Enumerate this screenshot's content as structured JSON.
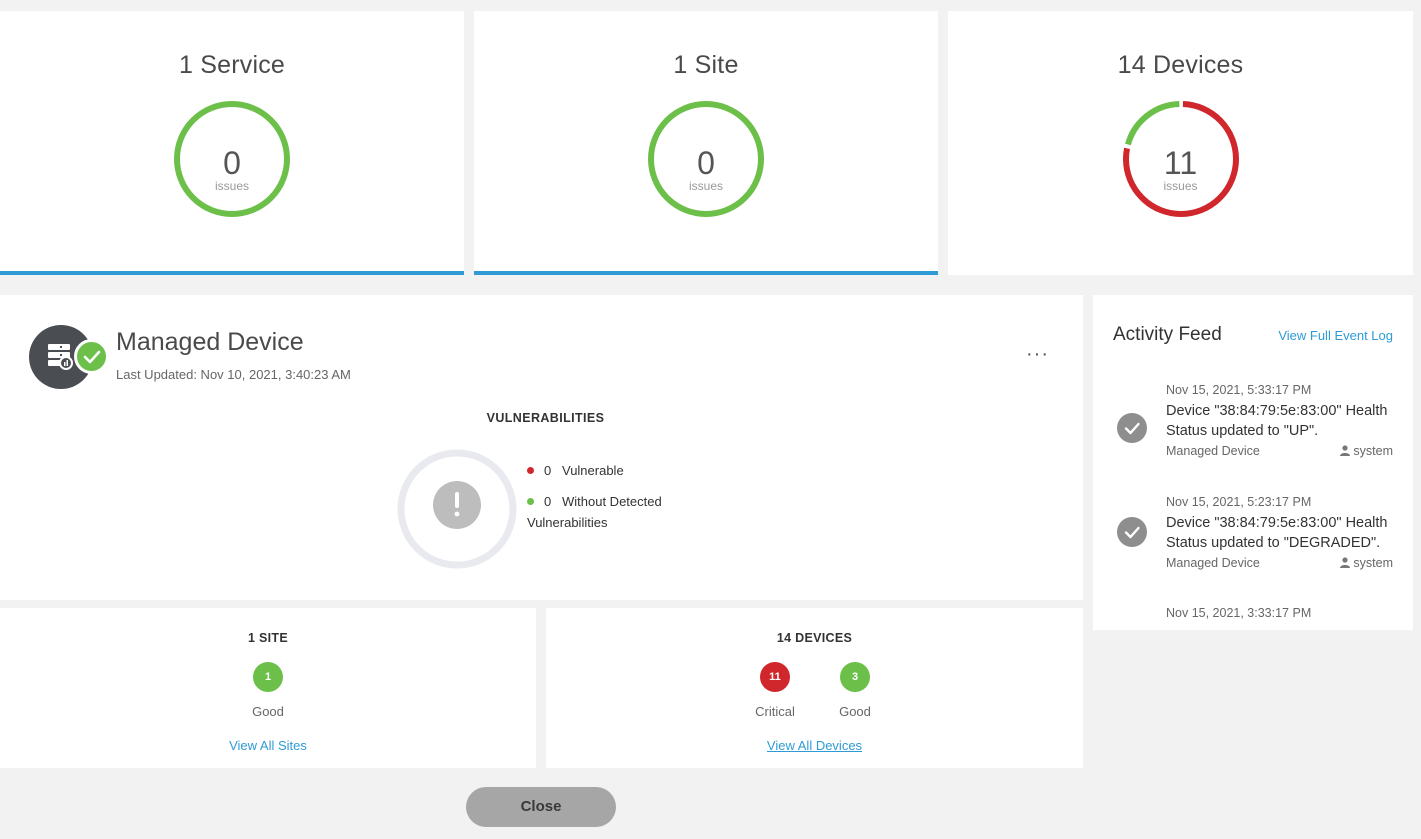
{
  "summary": {
    "service": {
      "title": "1 Service",
      "count": "0",
      "sub": "issues"
    },
    "site": {
      "title": "1 Site",
      "count": "0",
      "sub": "issues"
    },
    "devices": {
      "title": "14 Devices",
      "count": "11",
      "sub": "issues",
      "critical_fraction": 0.786,
      "good_fraction": 0.214
    }
  },
  "colors": {
    "good": "#6cc04a",
    "critical": "#d0272c",
    "accent": "#2e9bd6",
    "link": "#2e9bd6",
    "neutral_ring": "#e9eaef",
    "warn_icon": "#bdbdbd"
  },
  "device": {
    "name": "Managed Device",
    "last_updated": "Last Updated: Nov 10, 2021, 3:40:23 AM",
    "more_label": "···",
    "icon": "server-health-icon",
    "status_icon": "check-circle-icon"
  },
  "vulnerabilities": {
    "title": "VULNERABILITIES",
    "icon": "exclamation-icon",
    "legend": [
      {
        "count": "0",
        "label": "Vulnerable",
        "color": "#d0272c"
      },
      {
        "count": "0",
        "label": "Without Detected",
        "label2": "Vulnerabilities",
        "color": "#6cc04a"
      }
    ]
  },
  "sites_card": {
    "label": "1 SITE",
    "pills": [
      {
        "value": "1",
        "label": "Good",
        "color": "#6cc04a"
      }
    ],
    "link": "View All Sites"
  },
  "devices_card": {
    "label": "14 DEVICES",
    "pills": [
      {
        "value": "11",
        "label": "Critical",
        "color": "#d0272c"
      },
      {
        "value": "3",
        "label": "Good",
        "color": "#6cc04a"
      }
    ],
    "link": "View All Devices"
  },
  "activity_feed": {
    "title": "Activity Feed",
    "link": "View Full Event Log",
    "events": [
      {
        "time": "Nov 15, 2021, 5:33:17 PM",
        "message": "Device \"38:84:79:5e:83:00\" Health Status updated to \"UP\".",
        "source": "Managed Device",
        "user": "system"
      },
      {
        "time": "Nov 15, 2021, 5:23:17 PM",
        "message": "Device \"38:84:79:5e:83:00\" Health Status updated to \"DEGRADED\".",
        "source": "Managed Device",
        "user": "system"
      },
      {
        "time": "Nov 15, 2021, 3:33:17 PM"
      }
    ]
  },
  "close_label": "Close"
}
